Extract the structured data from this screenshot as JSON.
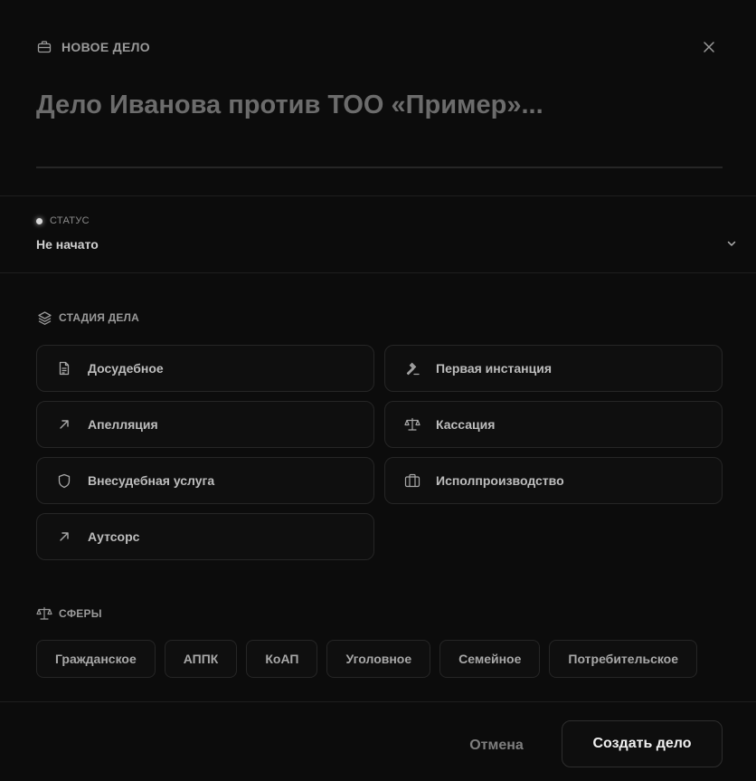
{
  "header": {
    "label": "НОВОЕ ДЕЛО",
    "icon": "briefcase-icon"
  },
  "title": {
    "value": "Дело Иванова против ТОО «Пример»..."
  },
  "status": {
    "caption": "СТАТУС",
    "value": "Не начато"
  },
  "stage": {
    "heading": "СТАДИЯ ДЕЛА",
    "items": [
      {
        "label": "Досудебное",
        "icon": "document-icon"
      },
      {
        "label": "Первая инстанция",
        "icon": "gavel-icon"
      },
      {
        "label": "Апелляция",
        "icon": "arrow-up-right-icon"
      },
      {
        "label": "Кассация",
        "icon": "scales-icon"
      },
      {
        "label": "Внесудебная услуга",
        "icon": "shield-icon"
      },
      {
        "label": "Исполпроизводство",
        "icon": "briefcase-icon"
      },
      {
        "label": "Аутсорс",
        "icon": "arrow-up-right-icon"
      }
    ]
  },
  "spheres": {
    "heading": "СФЕРЫ",
    "items": [
      "Гражданское",
      "АППК",
      "КоАП",
      "Уголовное",
      "Семейное",
      "Потребительское"
    ]
  },
  "footer": {
    "cancel": "Отмена",
    "create": "Создать дело"
  }
}
